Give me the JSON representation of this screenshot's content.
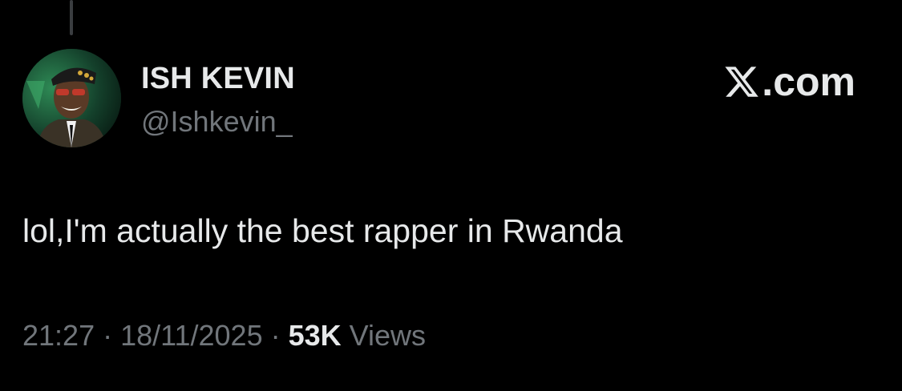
{
  "author": {
    "display_name": "ISH KEVIN",
    "handle": "@Ishkevin_"
  },
  "brand": {
    "text": ".com",
    "icon": "x-logo-icon"
  },
  "tweet": {
    "text": "lol,I'm actually the best rapper in Rwanda",
    "time": "21:27",
    "separator": " · ",
    "date": "18/11/2025",
    "views_count": "53K",
    "views_label": " Views"
  },
  "colors": {
    "background": "#000000",
    "primary_text": "#e7e9ea",
    "secondary_text": "#71767b",
    "thread_line": "#3a3d40"
  }
}
